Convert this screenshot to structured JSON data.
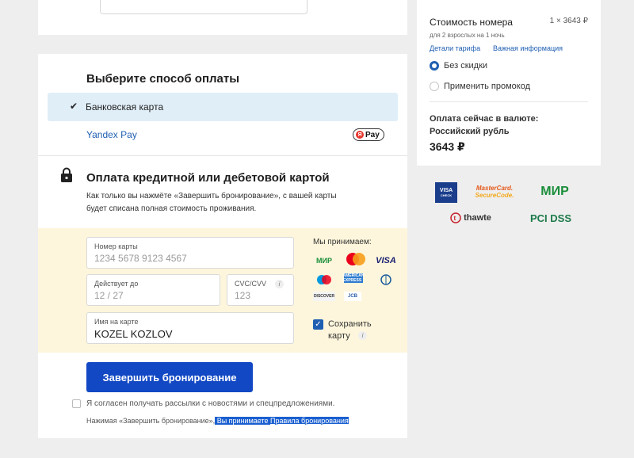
{
  "payment": {
    "method_title": "Выберите способ оплаты",
    "methods": [
      {
        "label": "Банковская карта",
        "selected": true
      },
      {
        "label": "Yandex Pay",
        "selected": false
      }
    ],
    "ypay_badge_text": "Pay",
    "ypay_badge_dot": "Я",
    "credit_title": "Оплата кредитной или дебетовой картой",
    "credit_desc": "Как только вы нажмёте «Завершить бронирование», с вашей карты будет списана полная стоимость проживания."
  },
  "form": {
    "card_label": "Номер карты",
    "card_placeholder": "1234 5678 9123 4567",
    "exp_label": "Действует до",
    "exp_placeholder": "12 / 27",
    "cvc_label": "CVC/CVV",
    "cvc_placeholder": "123",
    "name_label": "Имя на карте",
    "name_value": "KOZEL KOZLOV",
    "accept_title": "Мы принимаем:",
    "accepted_cards": {
      "mir": "МИР",
      "visa": "VISA",
      "amex": "AMERICAN EXPRESS",
      "discover": "DISCOVER",
      "jcb": "JCB"
    },
    "save_label": "Сохранить карту",
    "save_checked": true,
    "info_glyph": "i"
  },
  "actions": {
    "submit_label": "Завершить бронирование",
    "newsletter_label": "Я согласен получать рассылки с новостями и спецпредложениями.",
    "legal_prefix": "Нажимая «Завершить бронирование»,",
    "legal_highlight": " Вы принимаете ",
    "legal_link": "Правила бронирования"
  },
  "summary": {
    "room_title": "Стоимость номера",
    "room_price": "1 × 3643 ₽",
    "room_sub": "для 2 взрослых на 1 ночь",
    "tariff_link": "Детали тарифа",
    "info_link": "Важная информация",
    "discount_options": [
      {
        "label": "Без скидки",
        "selected": true
      },
      {
        "label": "Применить промокод",
        "selected": false
      }
    ],
    "pay_now": "Оплата сейчас в валюте: Российский рубль",
    "total": "3643 ₽"
  },
  "trust": {
    "visa_top": "VISA",
    "visa_bottom": "CHECK",
    "mc_line1": "MasterCard.",
    "mc_line2": "SecureCode.",
    "mir": "МИР",
    "thawte": "thawte",
    "pci": "PCI DSS"
  },
  "colors": {
    "accent": "#1248c4",
    "link": "#1f5fb2",
    "selected_row": "#e0eef8",
    "form_bg": "#fdf6dc"
  }
}
